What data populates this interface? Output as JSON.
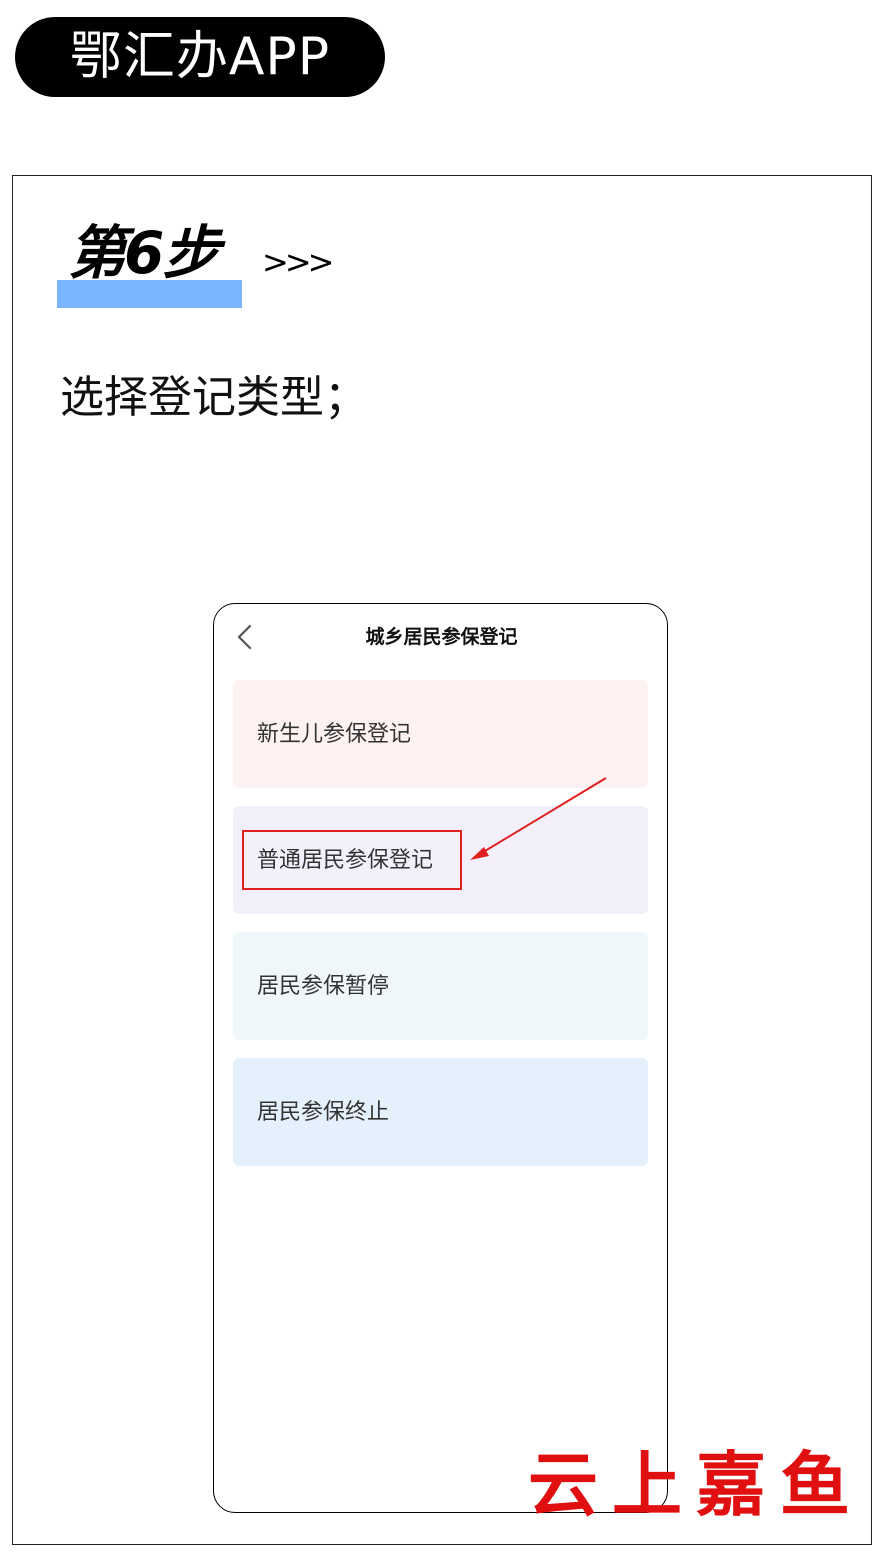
{
  "header": {
    "app_name": "鄂汇办APP"
  },
  "step": {
    "title": "第6步",
    "arrows": ">>>",
    "instruction": "选择登记类型；"
  },
  "phone": {
    "back_icon": "chevron-left-icon",
    "nav_title": "城乡居民参保登记",
    "options": [
      {
        "label": "新生儿参保登记",
        "color": "#fdf1f1"
      },
      {
        "label": "普通居民参保登记",
        "color": "#f3f0fc",
        "highlighted": true
      },
      {
        "label": "居民参保暂停",
        "color": "#eff7fb"
      },
      {
        "label": "居民参保终止",
        "color": "#e4f0fc"
      }
    ]
  },
  "annotation": {
    "highlight_color": "#e02020"
  },
  "watermark": {
    "text": "云上嘉鱼",
    "color": "#e01010"
  },
  "colors": {
    "step_highlight": "#7ab6ff",
    "pill_background": "#000000"
  }
}
